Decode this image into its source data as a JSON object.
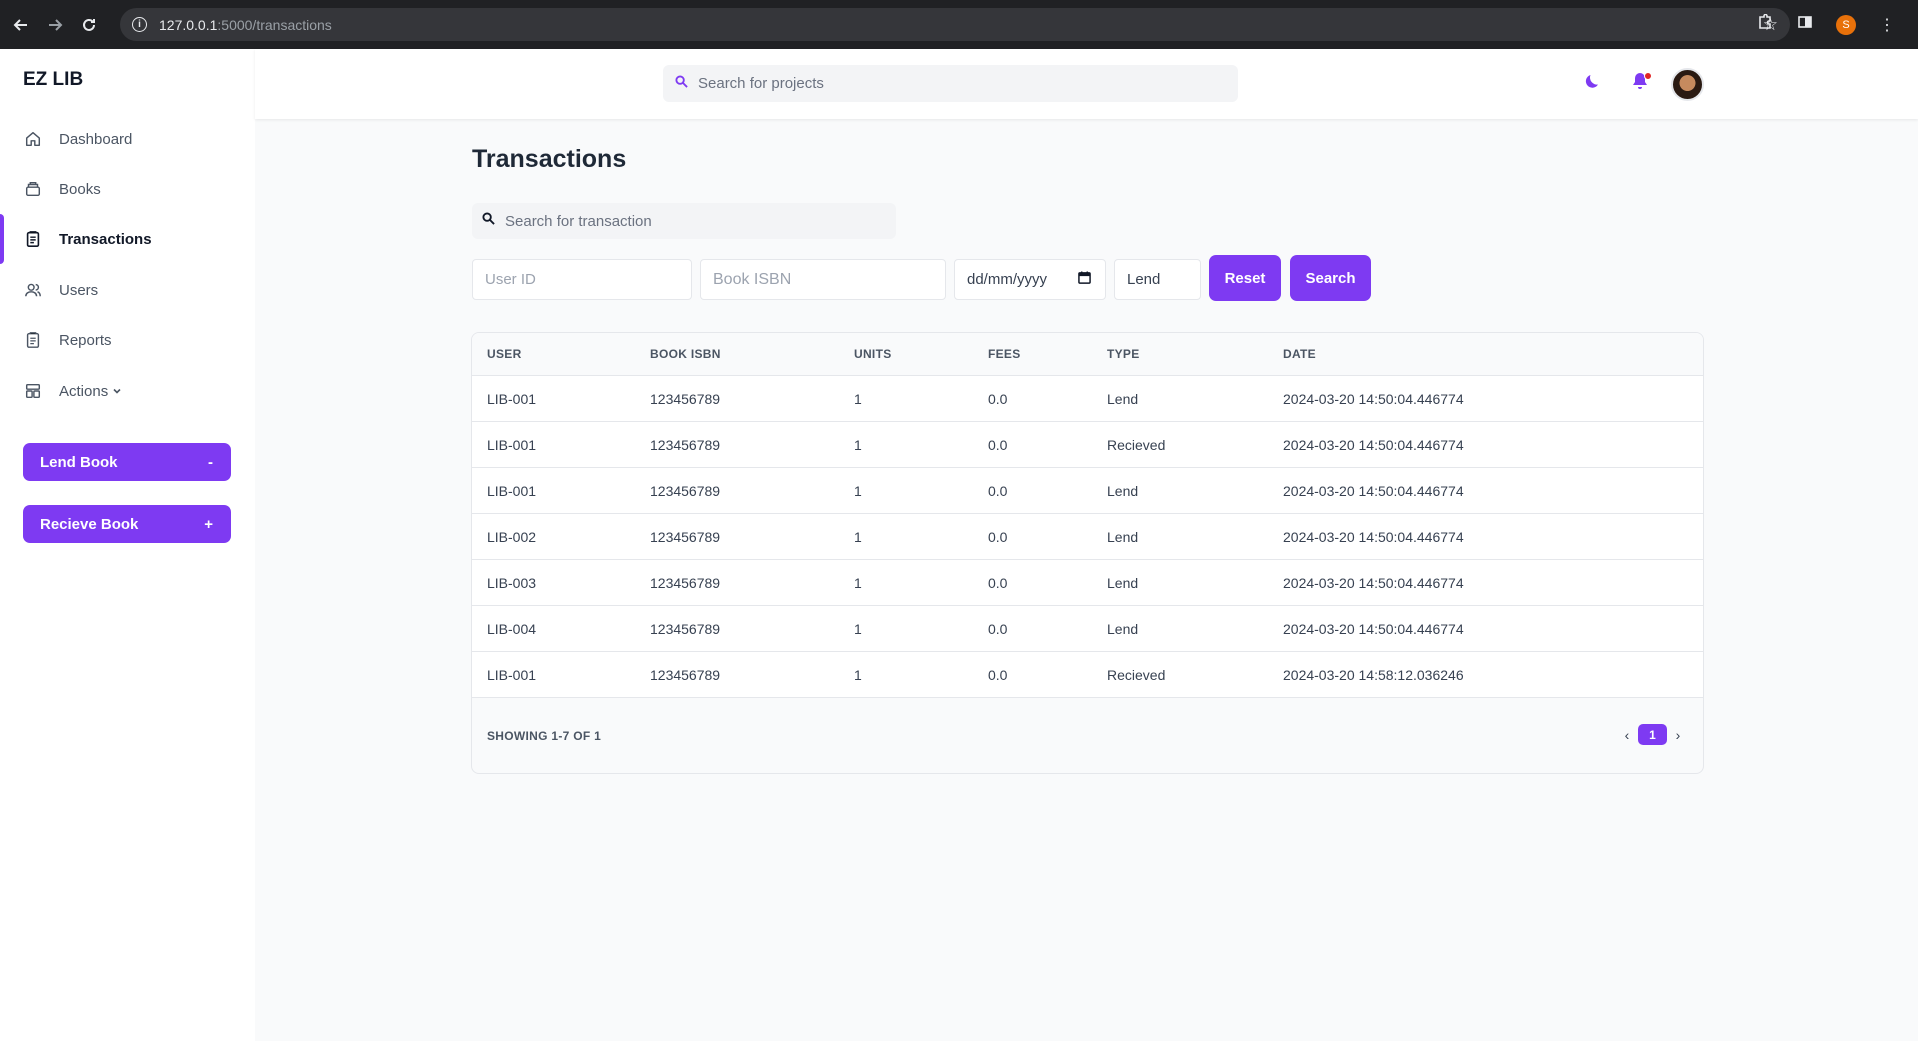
{
  "browser": {
    "url_host": "127.0.0.1",
    "url_path": ":5000/transactions",
    "profile_initial": "S"
  },
  "app": {
    "logo": "EZ LIB"
  },
  "sidebar": {
    "items": [
      {
        "label": "Dashboard",
        "icon": "home-icon"
      },
      {
        "label": "Books",
        "icon": "archive-icon"
      },
      {
        "label": "Transactions",
        "icon": "clipboard-icon",
        "active": true
      },
      {
        "label": "Users",
        "icon": "users-icon"
      },
      {
        "label": "Reports",
        "icon": "clipboard-icon"
      },
      {
        "label": "Actions",
        "icon": "templates-icon"
      }
    ],
    "lend_button": {
      "label": "Lend Book",
      "symbol": "-"
    },
    "receive_button": {
      "label": "Recieve Book",
      "symbol": "+"
    }
  },
  "header": {
    "search_placeholder": "Search for projects"
  },
  "main": {
    "title": "Transactions",
    "search_placeholder": "Search for transaction",
    "filters": {
      "user_id_placeholder": "User ID",
      "isbn_placeholder": "Book ISBN",
      "date_placeholder": "dd/mm/yyyy",
      "type_value": "Lend"
    },
    "reset_label": "Reset",
    "search_label": "Search"
  },
  "table": {
    "columns": [
      "USER",
      "BOOK ISBN",
      "UNITS",
      "FEES",
      "TYPE",
      "DATE"
    ],
    "rows": [
      [
        "LIB-001",
        "123456789",
        "1",
        "0.0",
        "Lend",
        "2024-03-20 14:50:04.446774"
      ],
      [
        "LIB-001",
        "123456789",
        "1",
        "0.0",
        "Recieved",
        "2024-03-20 14:50:04.446774"
      ],
      [
        "LIB-001",
        "123456789",
        "1",
        "0.0",
        "Lend",
        "2024-03-20 14:50:04.446774"
      ],
      [
        "LIB-002",
        "123456789",
        "1",
        "0.0",
        "Lend",
        "2024-03-20 14:50:04.446774"
      ],
      [
        "LIB-003",
        "123456789",
        "1",
        "0.0",
        "Lend",
        "2024-03-20 14:50:04.446774"
      ],
      [
        "LIB-004",
        "123456789",
        "1",
        "0.0",
        "Lend",
        "2024-03-20 14:50:04.446774"
      ],
      [
        "LIB-001",
        "123456789",
        "1",
        "0.0",
        "Recieved",
        "2024-03-20 14:58:12.036246"
      ]
    ],
    "showing": "SHOWING 1-7 OF 1",
    "current_page": "1"
  },
  "colors": {
    "accent": "#7e3af2",
    "notification": "#e02424"
  }
}
